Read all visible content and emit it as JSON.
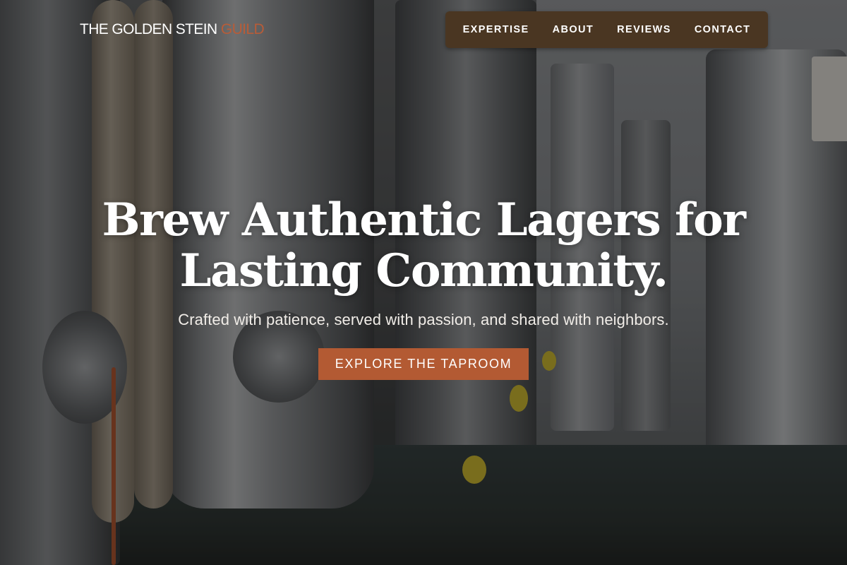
{
  "brand": {
    "name_main": "THE GOLDEN STEIN",
    "name_accent": "GUILD",
    "accent_color": "#b85c38"
  },
  "nav": {
    "items": [
      {
        "label": "EXPERTISE"
      },
      {
        "label": "ABOUT"
      },
      {
        "label": "REVIEWS"
      },
      {
        "label": "CONTACT"
      }
    ],
    "background_color": "#4a3622"
  },
  "hero": {
    "title_line1": "Brew Authentic Lagers for",
    "title_line2": "Lasting Community.",
    "subtitle": "Crafted with patience, served with passion, and shared with neighbors.",
    "cta_label": "EXPLORE THE TAPROOM",
    "cta_color": "#b35a33",
    "background_image": "brewery fermentation tanks"
  }
}
